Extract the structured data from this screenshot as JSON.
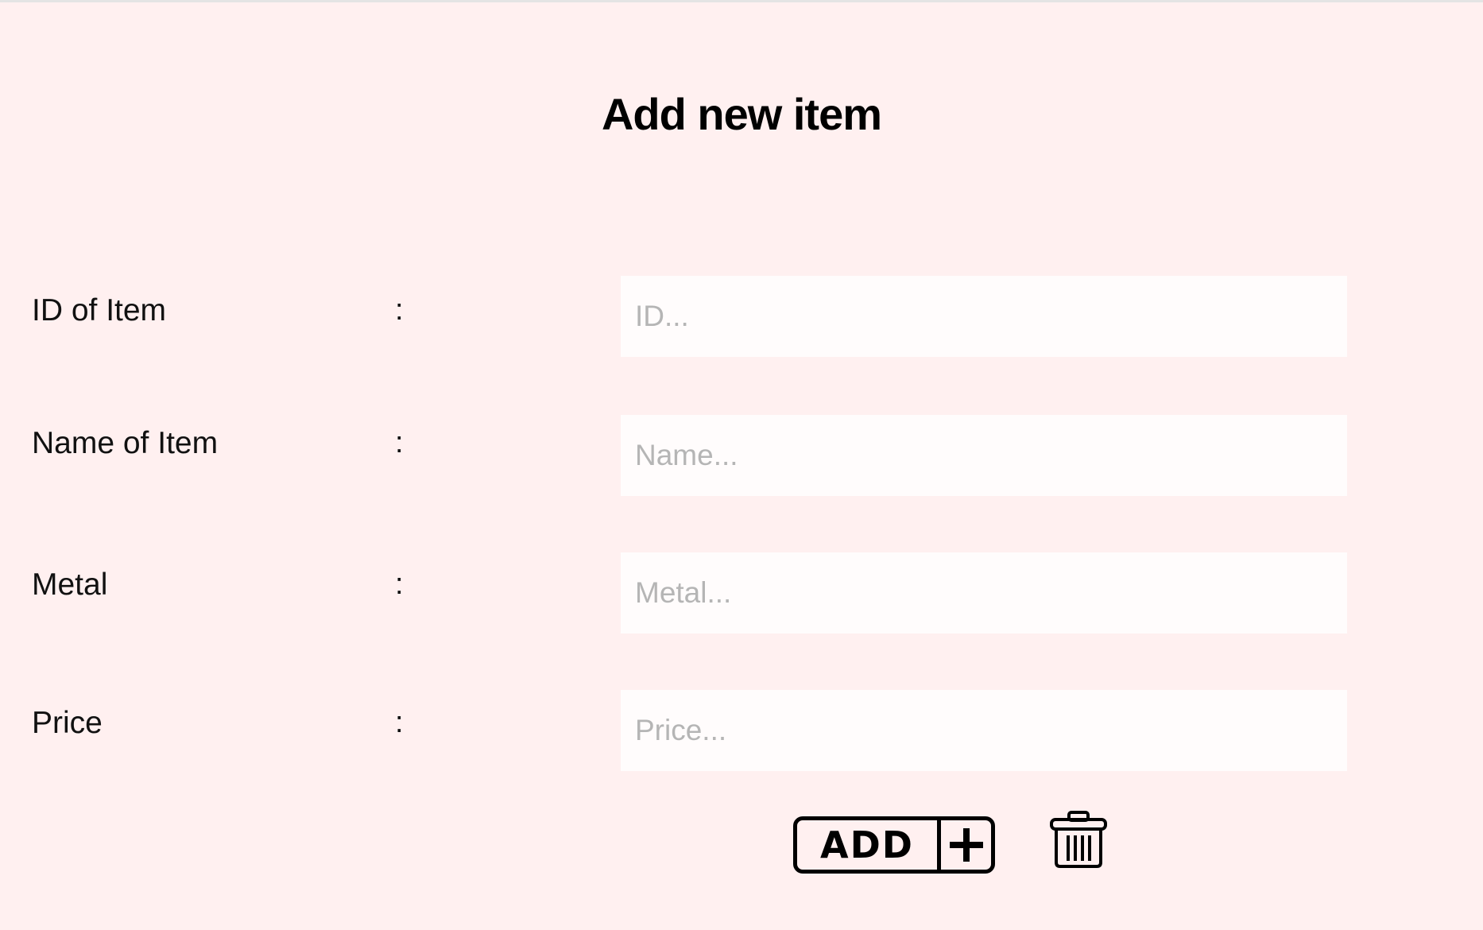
{
  "form": {
    "title": "Add new item",
    "fields": [
      {
        "label": "ID of Item",
        "separator": ":",
        "placeholder": "ID...",
        "value": ""
      },
      {
        "label": "Name of Item",
        "separator": ":",
        "placeholder": "Name...",
        "value": ""
      },
      {
        "label": "Metal",
        "separator": ":",
        "placeholder": "Metal...",
        "value": ""
      },
      {
        "label": "Price",
        "separator": ":",
        "placeholder": "Price...",
        "value": ""
      }
    ],
    "actions": {
      "add_label": "ADD",
      "add_icon": "plus-icon",
      "delete_icon": "trash-icon"
    }
  },
  "colors": {
    "background": "#fff0f0",
    "field_background": "#fffcfc",
    "placeholder": "#b5b5b5",
    "text": "#111111"
  }
}
